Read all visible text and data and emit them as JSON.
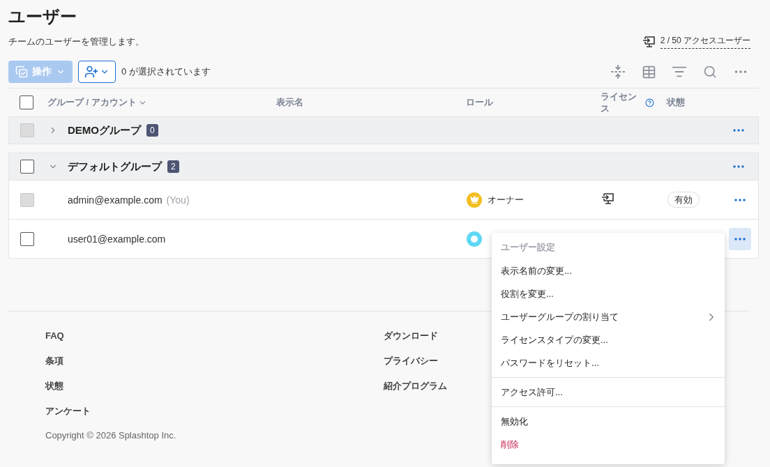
{
  "title": "ユーザー",
  "subtitle": "チームのユーザーを管理します。",
  "access_users": "2 / 50 アクセスユーザー",
  "toolbar": {
    "actions_button": {
      "label": "操作",
      "disabled": true
    },
    "selected_count": "0 が選択されています"
  },
  "table": {
    "select_all": {
      "checked": false,
      "disabled": false
    },
    "columns": [
      {
        "label": "グループ / アカウント",
        "sortable": true
      },
      {
        "label": "表示名",
        "sortable": false
      },
      {
        "label": "ロール",
        "sortable": false
      },
      {
        "label": "ライセンス",
        "sortable": false,
        "help": true
      },
      {
        "label": "状態",
        "sortable": false
      }
    ],
    "groups": [
      {
        "name": "DEMOグループ",
        "count": "0",
        "expanded": false,
        "checkbox_disabled": true
      },
      {
        "name": "デフォルトグループ",
        "count": "2",
        "expanded": true,
        "checkbox_disabled": false,
        "rows": [
          {
            "account": "admin@example.com",
            "you_tag": "(You)",
            "checkbox_disabled": true,
            "role": {
              "kind": "owner",
              "label": "オーナー"
            },
            "license_icon": true,
            "status": "有効",
            "menu_open": false
          },
          {
            "account": "user01@example.com",
            "checkbox_disabled": false,
            "role": {
              "kind": "member"
            },
            "menu_open": true
          }
        ]
      }
    ]
  },
  "context_menu": {
    "title": "ユーザー設定",
    "sections": [
      {
        "items": [
          {
            "label": "表示名前の変更...",
            "kind": "item"
          },
          {
            "label": "役割を変更...",
            "kind": "item"
          },
          {
            "label": "ユーザーグループの割り当て",
            "kind": "submenu"
          },
          {
            "label": "ライセンスタイプの変更...",
            "kind": "item"
          },
          {
            "label": "パスワードをリセット...",
            "kind": "item"
          }
        ]
      },
      {
        "items": [
          {
            "label": "アクセス許可...",
            "kind": "item"
          }
        ]
      },
      {
        "items": [
          {
            "label": "無効化",
            "kind": "item"
          },
          {
            "label": "削除",
            "kind": "danger"
          }
        ]
      }
    ]
  },
  "footer": {
    "columns": [
      [
        "FAQ",
        "条項",
        "状態",
        "アンケート"
      ],
      [
        "ダウンロード",
        "プライバシー",
        "紹介プログラム"
      ]
    ],
    "copyright": "Copyright © 2026 Splashtop Inc."
  }
}
